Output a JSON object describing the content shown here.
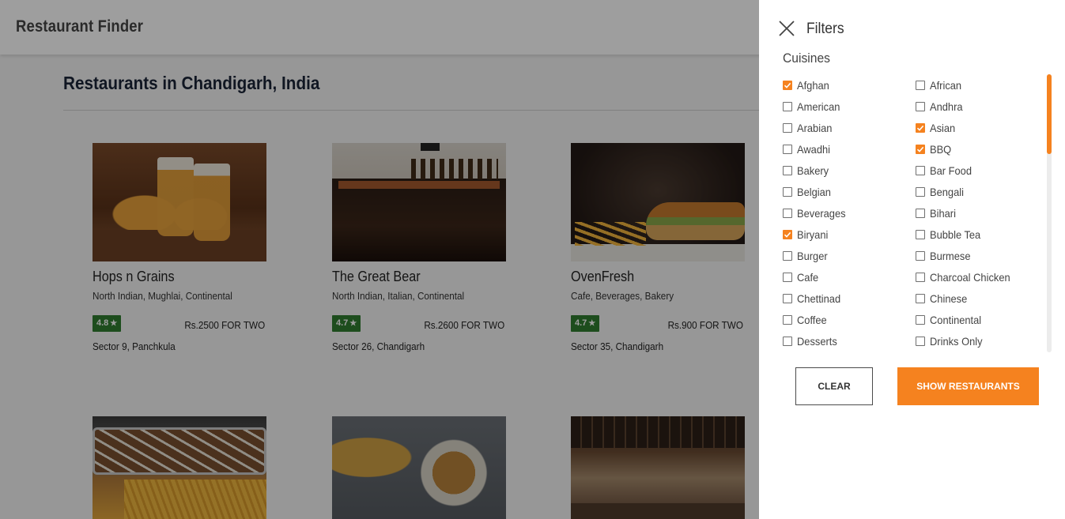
{
  "app": {
    "title": "Restaurant Finder"
  },
  "main": {
    "heading": "Restaurants in Chandigarh, India",
    "restaurants": [
      {
        "name": "Hops n Grains",
        "cuisines": "North Indian, Mughlai, Continental",
        "rating": "4.8",
        "price": "Rs.2500 FOR TWO",
        "location": "Sector 9, Panchkula"
      },
      {
        "name": "The Great Bear",
        "cuisines": "North Indian, Italian, Continental",
        "rating": "4.7",
        "price": "Rs.2600 FOR TWO",
        "location": "Sector 26, Chandigarh"
      },
      {
        "name": "OvenFresh",
        "cuisines": "Cafe, Beverages, Bakery",
        "rating": "4.7",
        "price": "Rs.900 FOR TWO",
        "location": "Sector 35, Chandigarh"
      }
    ]
  },
  "filters": {
    "title": "Filters",
    "section_label": "Cuisines",
    "cuisines": [
      {
        "label": "Afghan",
        "checked": true
      },
      {
        "label": "African",
        "checked": false
      },
      {
        "label": "American",
        "checked": false
      },
      {
        "label": "Andhra",
        "checked": false
      },
      {
        "label": "Arabian",
        "checked": false
      },
      {
        "label": "Asian",
        "checked": true
      },
      {
        "label": "Awadhi",
        "checked": false
      },
      {
        "label": "BBQ",
        "checked": true
      },
      {
        "label": "Bakery",
        "checked": false
      },
      {
        "label": "Bar Food",
        "checked": false
      },
      {
        "label": "Belgian",
        "checked": false
      },
      {
        "label": "Bengali",
        "checked": false
      },
      {
        "label": "Beverages",
        "checked": false
      },
      {
        "label": "Bihari",
        "checked": false
      },
      {
        "label": "Biryani",
        "checked": true
      },
      {
        "label": "Bubble Tea",
        "checked": false
      },
      {
        "label": "Burger",
        "checked": false
      },
      {
        "label": "Burmese",
        "checked": false
      },
      {
        "label": "Cafe",
        "checked": false
      },
      {
        "label": "Charcoal Chicken",
        "checked": false
      },
      {
        "label": "Chettinad",
        "checked": false
      },
      {
        "label": "Chinese",
        "checked": false
      },
      {
        "label": "Coffee",
        "checked": false
      },
      {
        "label": "Continental",
        "checked": false
      },
      {
        "label": "Desserts",
        "checked": false
      },
      {
        "label": "Drinks Only",
        "checked": false
      }
    ],
    "clear_label": "CLEAR",
    "show_label": "SHOW RESTAURANTS"
  },
  "colors": {
    "accent": "#f5821f",
    "rating_badge": "#2f7d2f",
    "overlay": "rgba(0,0,0,0.38)"
  }
}
